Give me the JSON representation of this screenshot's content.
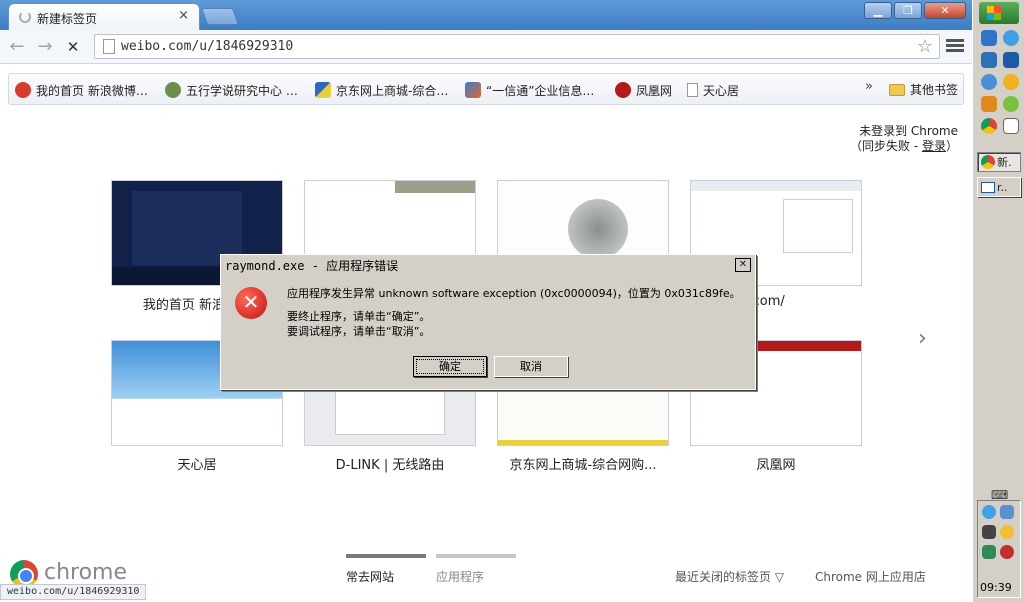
{
  "browser": {
    "tab_title": "新建标签页",
    "tab_close": "×",
    "window_buttons": [
      "▁",
      "❐",
      "✕"
    ],
    "address": "weibo.com/u/1846929310",
    "back": "←",
    "forward": "→",
    "stop": "✕",
    "star": "☆"
  },
  "bookmarks": {
    "items": [
      {
        "label": "我的首页 新浪微博…",
        "color": "#d93a2b"
      },
      {
        "label": "五行学说研究中心 …",
        "color": "#6b8f4a"
      },
      {
        "label": "京东网上商城-综合…",
        "color": "#2e68c4"
      },
      {
        "label": "“一信通”企业信息…",
        "color": "#3a7bd5"
      },
      {
        "label": "凤凰网",
        "color": "#b31b1b"
      },
      {
        "label": "天心居",
        "color": "#cccccc"
      }
    ],
    "more": "»",
    "other_label": "其他书签"
  },
  "signin": {
    "line1": "未登录到 Chrome",
    "line2_prefix": "（同步失败 - ",
    "line2_link": "登录",
    "line2_suffix": "）"
  },
  "thumbnails": [
    {
      "label": "我的首页 新浪微博"
    },
    {
      "label": ""
    },
    {
      "label": ""
    },
    {
      "label": "mail.qq.com/"
    },
    {
      "label": "天心居"
    },
    {
      "label": "D-LINK | 无线路由"
    },
    {
      "label": "京东网上商城-综合网购..."
    },
    {
      "label": "凤凰网"
    }
  ],
  "next_arrow": "›",
  "bottom": {
    "chrome_word": "chrome",
    "tab_frequent": "常去网站",
    "tab_apps": "应用程序",
    "recently_closed": "最近关闭的标签页 ▽",
    "webstore": "Chrome 网上应用店"
  },
  "status_url": "weibo.com/u/1846929310",
  "dialog": {
    "title": "raymond.exe - 应用程序错误",
    "close": "✕",
    "icon": "✕",
    "line1": "应用程序发生异常 unknown software exception (0xc0000094)，位置为 0x031c89fe。",
    "line2": "要终止程序，请单击“确定”。",
    "line3": "要调试程序，请单击“取消”。",
    "ok": "确定",
    "cancel": "取消"
  },
  "taskbar": {
    "items": [
      {
        "label": "新.",
        "active": true
      },
      {
        "label": "r..",
        "active": false
      }
    ],
    "clock": "09:39",
    "kbd": "⌨"
  }
}
